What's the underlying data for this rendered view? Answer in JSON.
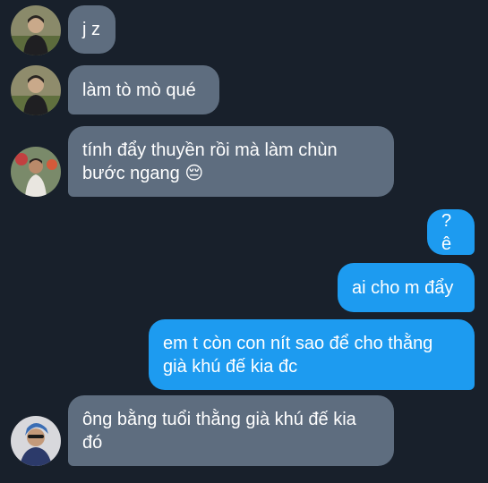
{
  "conversation": {
    "messages": [
      {
        "sender": "incoming",
        "avatar": "avatar-1",
        "text": "j z"
      },
      {
        "sender": "incoming",
        "avatar": "avatar-1",
        "text": "làm tò mò qué"
      },
      {
        "sender": "incoming",
        "avatar": "avatar-2",
        "text": "tính đẩy thuyền rồi mà làm chùn\nbước ngang 😔"
      },
      {
        "sender": "outgoing",
        "text": "?ê"
      },
      {
        "sender": "outgoing",
        "text": "ai cho m đẩy"
      },
      {
        "sender": "outgoing",
        "text": "em t còn con nít sao để cho thằng\ngià khú đế kia đc"
      },
      {
        "sender": "incoming",
        "avatar": "avatar-3",
        "text": "ông bằng tuổi thằng già khú đế kia\nđó"
      }
    ]
  },
  "colors": {
    "background": "#18202b",
    "incoming_bubble": "#5e6d7f",
    "outgoing_bubble": "#1d9bf0",
    "text": "#ffffff"
  }
}
